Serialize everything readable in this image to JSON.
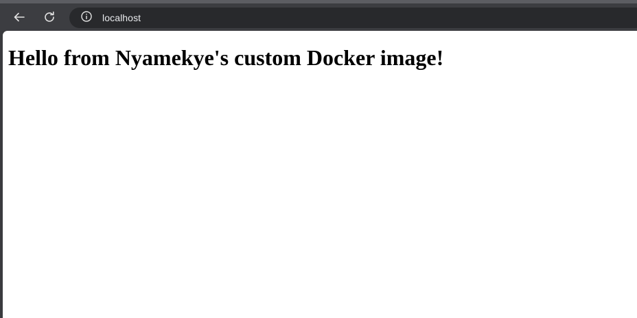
{
  "browser": {
    "address_bar": {
      "url": "localhost"
    },
    "icons": {
      "back": "arrow-left-icon",
      "reload": "reload-icon",
      "site_info": "info-icon"
    },
    "colors": {
      "toolbar": "#3c3d41",
      "omnibox": "#28292c",
      "icon": "#e3e3e3"
    }
  },
  "page": {
    "heading": "Hello from Nyamekye's custom Docker image!"
  }
}
